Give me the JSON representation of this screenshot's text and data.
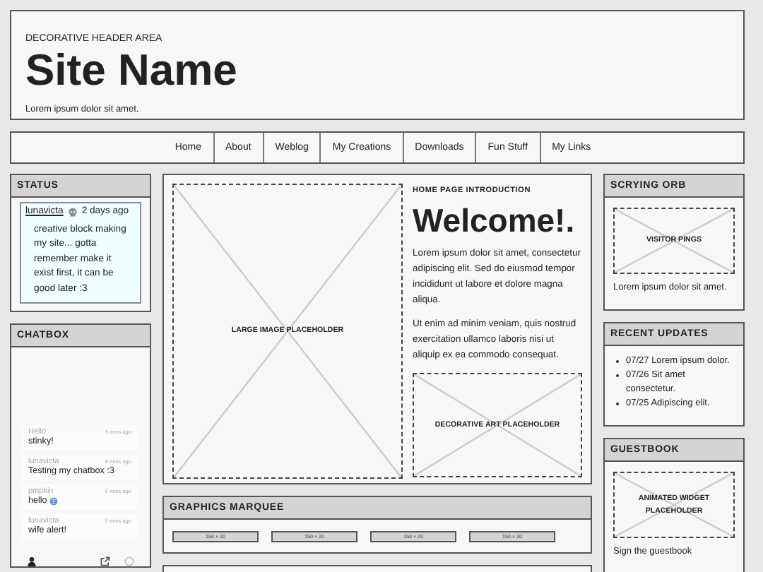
{
  "header": {
    "eyebrow": "DECORATIVE HEADER AREA",
    "title": "Site Name",
    "tagline": "Lorem ipsum dolor sit amet."
  },
  "nav": [
    "Home",
    "About",
    "Weblog",
    "My Creations",
    "Downloads",
    "Fun Stuff",
    "My Links"
  ],
  "status": {
    "title": "STATUS",
    "author": "lunavicta",
    "time": "2 days ago",
    "text": "creative block making my site... gotta remember make it exist first, it can be good later :3"
  },
  "chatbox": {
    "title": "CHATBOX",
    "messages": [
      {
        "name": "Hello",
        "time": "9 mins ago",
        "text": "stinky!",
        "has_icon": false
      },
      {
        "name": "lunavicta",
        "time": "9 mins ago",
        "text": "Testing my chatbox :3",
        "has_icon": false
      },
      {
        "name": "pmpkin",
        "time": "6 mins ago",
        "text": "hello",
        "has_icon": true
      },
      {
        "name": "lunavicta",
        "time": "5 mins ago",
        "text": "wife alert!",
        "has_icon": false
      }
    ]
  },
  "main": {
    "image_label": "LARGE IMAGE PLACEHOLDER",
    "intro_heading": "HOME PAGE INTRODUCTION",
    "welcome": "Welcome!.",
    "paragraphs": [
      "Lorem ipsum dolor sit amet, consectetur adipiscing elit. Sed do eiusmod tempor incididunt ut labore et dolore magna aliqua.",
      "Ut enim ad minim veniam, quis nostrud exercitation ullamco laboris nisi ut aliquip ex ea commodo consequat."
    ],
    "art_label": "DECORATIVE ART PLACEHOLDER"
  },
  "marquee": {
    "title": "GRAPHICS MARQUEE",
    "buttons": [
      "150 × 20",
      "150 × 20",
      "150 × 20",
      "150 × 20"
    ]
  },
  "orb": {
    "title": "SCRYING ORB",
    "placeholder": "VISITOR PINGS",
    "text": "Lorem ipsum dolor sit amet."
  },
  "updates": {
    "title": "RECENT UPDATES",
    "items": [
      "07/27 Lorem ipsum dolor.",
      "07/26 Sit amet consectetur.",
      "07/25 Adipiscing elit."
    ]
  },
  "guestbook": {
    "title": "GUESTBOOK",
    "placeholder": "ANIMATED WIDGET PLACEHOLDER",
    "text": "Sign the guestbook"
  }
}
